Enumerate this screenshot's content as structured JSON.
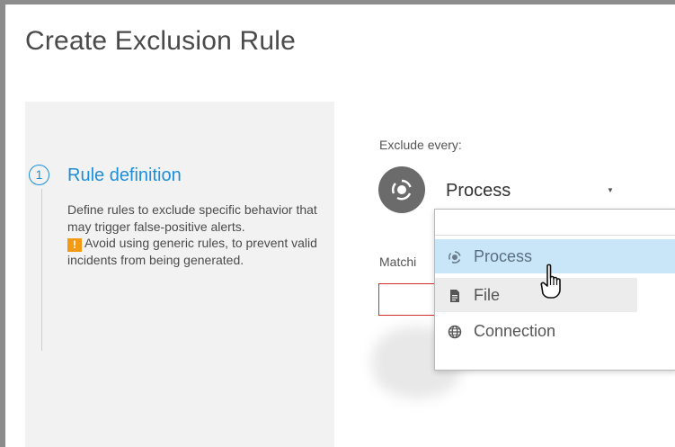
{
  "page": {
    "title": "Create Exclusion Rule"
  },
  "steps": [
    {
      "number": "1",
      "title": "Rule definition",
      "description": "Define rules to exclude specific behavior that may trigger false-positive alerts.",
      "warning": "Avoid using generic rules, to prevent valid incidents from being generated.",
      "warning_badge": "!"
    }
  ],
  "form": {
    "exclude_label": "Exclude every:",
    "exclude_value": "Process",
    "matching_label": "Matchi"
  },
  "dropdown": {
    "options": [
      {
        "label": "Process",
        "icon": "process-icon",
        "state": "hovered"
      },
      {
        "label": "File",
        "icon": "file-icon",
        "state": "normal"
      },
      {
        "label": "Connection",
        "icon": "globe-icon",
        "state": "normal"
      }
    ]
  },
  "colors": {
    "accent": "#1f8ed8",
    "warning": "#f39a14",
    "error_border": "#d62b2b",
    "hover_bg": "#c8e6f8"
  }
}
